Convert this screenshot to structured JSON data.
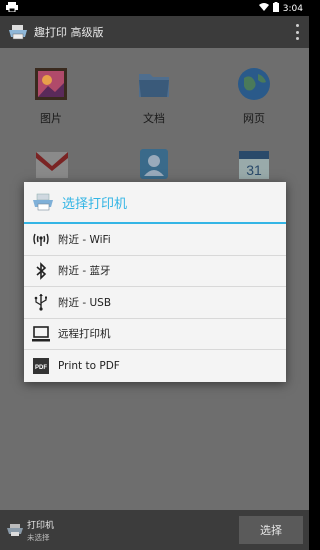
{
  "status_bar": {
    "time": "3:04"
  },
  "app_bar": {
    "title": "趣打印 高级版"
  },
  "grid": [
    {
      "label": "图片"
    },
    {
      "label": "文档"
    },
    {
      "label": "网页"
    }
  ],
  "dialog": {
    "title": "选择打印机",
    "options": [
      {
        "label": "附近 - WiFi",
        "icon": "wifi-signal-icon"
      },
      {
        "label": "附近 - 蓝牙",
        "icon": "bluetooth-icon"
      },
      {
        "label": "附近 - USB",
        "icon": "usb-icon"
      },
      {
        "label": "远程打印机",
        "icon": "computer-icon"
      },
      {
        "label": "Print to PDF",
        "icon": "pdf-icon"
      }
    ]
  },
  "bottom_bar": {
    "printer_name": "打印机",
    "printer_status": "未选择",
    "select_label": "选择"
  },
  "colors": {
    "accent": "#33b5e5",
    "action_bar": "#3b3b3b",
    "dim_background": "#6e6e6e"
  }
}
